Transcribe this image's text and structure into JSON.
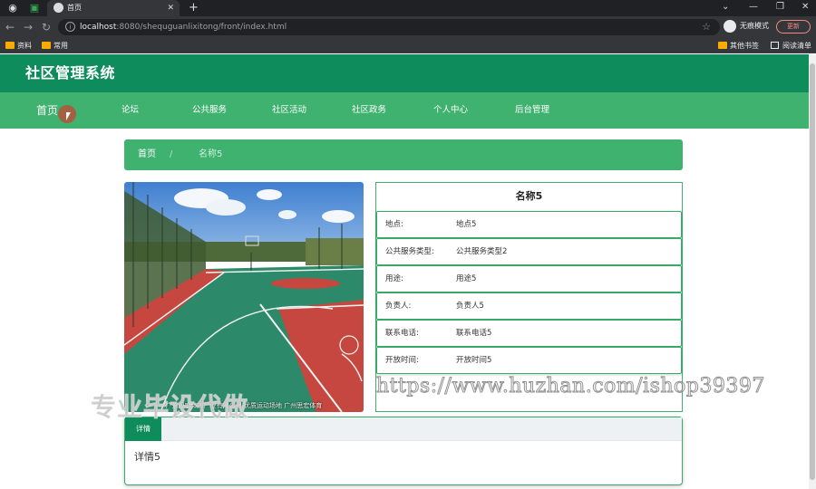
{
  "browser": {
    "tab_title": "首页",
    "url_host": "localhost",
    "url_rest": ":8080/shequguanlixitong/front/index.html",
    "incognito_label": "无痕模式",
    "update_label": "更新",
    "bookmarks": [
      "资料",
      "常用"
    ],
    "bookmarks_right": [
      "其他书签",
      "阅读清单"
    ]
  },
  "header": {
    "title": "社区管理系统"
  },
  "nav": {
    "items": [
      "首页",
      "论坛",
      "公共服务",
      "社区活动",
      "社区政务",
      "个人中心",
      "后台管理"
    ]
  },
  "breadcrumb": {
    "home": "首页",
    "separator": "/",
    "current": "名称5"
  },
  "photo": {
    "caption": "广州思宏体育产业有限公司 优质运动场地 广州思宏体育"
  },
  "detail": {
    "title": "名称5",
    "rows": [
      {
        "label": "地点:",
        "value": "地点5"
      },
      {
        "label": "公共服务类型:",
        "value": "公共服务类型2"
      },
      {
        "label": "用途:",
        "value": "用途5"
      },
      {
        "label": "负责人:",
        "value": "负责人5"
      },
      {
        "label": "联系电话:",
        "value": "联系电话5"
      },
      {
        "label": "开放时间:",
        "value": "开放时间5"
      }
    ]
  },
  "details_panel": {
    "tab_label": "详情",
    "body_text": "详情5"
  },
  "watermarks": {
    "url": "https://www.huzhan.com/ishop39397",
    "slogan": "专业毕设代做"
  },
  "colors": {
    "header_green": "#0f8c5c",
    "nav_green": "#3fb26f"
  }
}
